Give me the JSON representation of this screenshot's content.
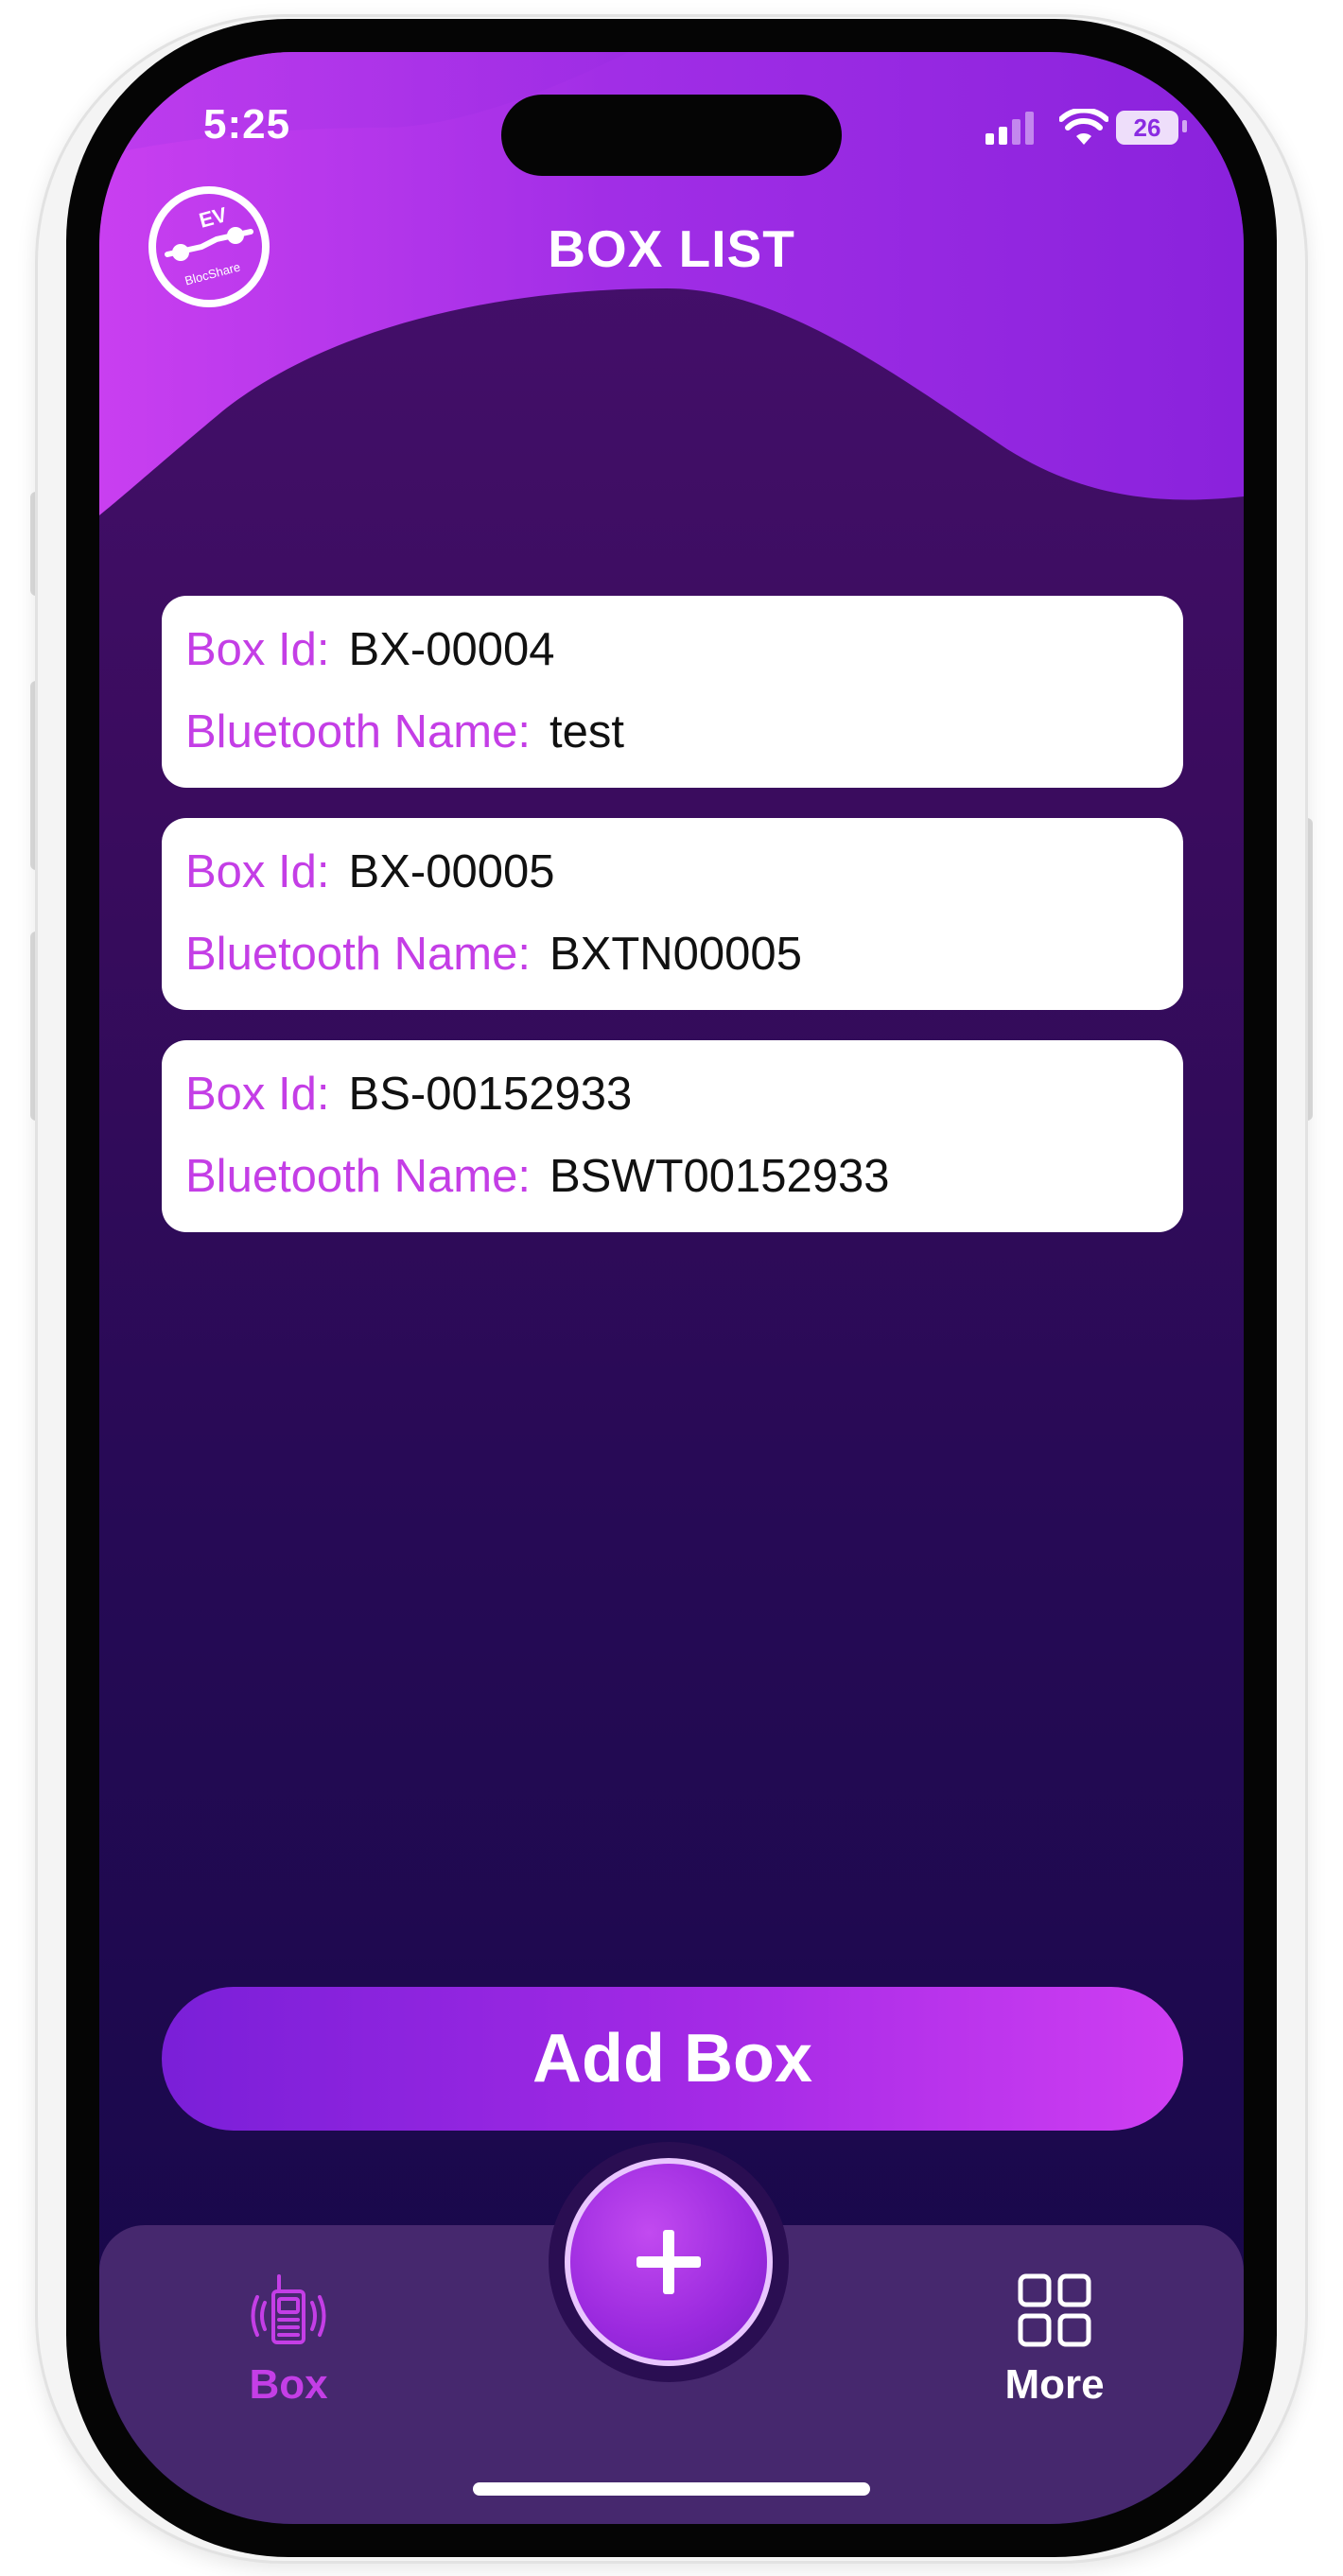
{
  "status_bar": {
    "time": "5:25",
    "battery_level": "26"
  },
  "header": {
    "logo_text_top": "EV",
    "logo_text_bottom": "BlocShare",
    "title": "BOX LIST"
  },
  "labels": {
    "box_id": "Box Id:",
    "bluetooth_name": "Bluetooth Name:"
  },
  "boxes": [
    {
      "box_id": "BX-00004",
      "bluetooth_name": "test"
    },
    {
      "box_id": "BX-00005",
      "bluetooth_name": "BXTN00005"
    },
    {
      "box_id": "BS-00152933",
      "bluetooth_name": "BSWT00152933"
    }
  ],
  "add_button_label": "Add Box",
  "tab_bar": {
    "tabs": [
      {
        "label": "Box",
        "icon": "box-device-icon",
        "active": true
      },
      {
        "label": "More",
        "icon": "grid-icon",
        "active": false
      }
    ],
    "center_button_icon": "plus-icon"
  },
  "colors": {
    "accent": "#c43ee6",
    "button_gradient_start": "#7a1fd8",
    "button_gradient_end": "#cf3ef2",
    "background_dark": "#150848",
    "tab_bar": "#46286e"
  }
}
